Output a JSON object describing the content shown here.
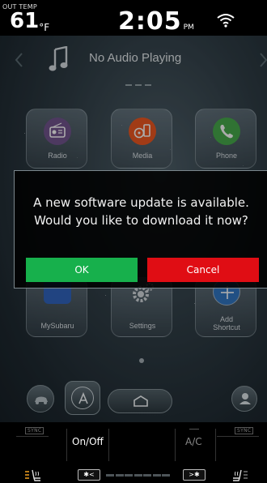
{
  "status_bar": {
    "out_temp_label": "OUT TEMP",
    "out_temp_value": "61",
    "out_temp_unit": "°F",
    "time": "2:05",
    "ampm": "PM",
    "wifi_icon": "wifi-icon"
  },
  "audio": {
    "title": "No Audio Playing",
    "prev_icon": "chevron-left-icon",
    "next_icon": "chevron-right-icon",
    "music_icon": "music-note-icon"
  },
  "apps": [
    {
      "label": "Radio",
      "icon": "radio-icon",
      "color": "#6b4f86"
    },
    {
      "label": "Media",
      "icon": "media-icon",
      "color": "#e0531f"
    },
    {
      "label": "Phone",
      "icon": "phone-icon",
      "color": "#43a047"
    },
    {
      "label": "MySubaru",
      "icon": "mysubaru-icon",
      "color": "#2f5fb3"
    },
    {
      "label": "Settings",
      "icon": "gear-icon",
      "color": "#6a747a"
    },
    {
      "label": "Add Shortcut",
      "label_line1": "Add",
      "label_line2": "Shortcut",
      "icon": "plus-icon",
      "color": "#2f6fb8"
    }
  ],
  "bottom_nav": {
    "car_icon": "car-icon",
    "a_icon": "assistant-icon",
    "home_icon": "home-icon",
    "profile_icon": "profile-icon"
  },
  "dialog": {
    "line1": "A new software update is available.",
    "line2": "Would you like to download it now?",
    "ok_label": "OK",
    "cancel_label": "Cancel",
    "ok_color": "#17b04c",
    "cancel_color": "#e00d14"
  },
  "climate": {
    "sync_left": "SYNC",
    "sync_right": "SYNC",
    "onoff_label": "On/Off",
    "ac_label": "A/C",
    "fan_down_label": "✱<",
    "fan_up_label": ">✱"
  }
}
